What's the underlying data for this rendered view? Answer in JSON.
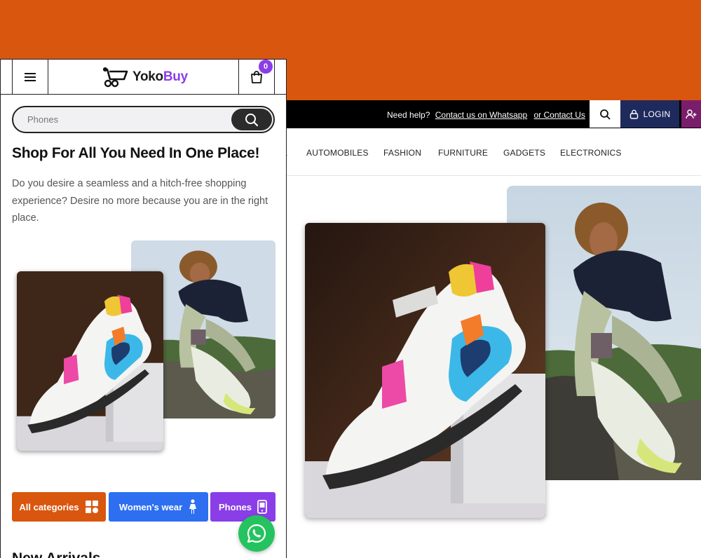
{
  "colors": {
    "orange": "#d9560f",
    "purple": "#8a3ee8",
    "blue": "#2d6ff0",
    "green": "#25c35f",
    "navy": "#1f2a5c"
  },
  "desktop": {
    "help": {
      "prefix": "Need help?",
      "whatsapp_link": "Contact us on Whatsapp",
      "contact_link": "or Contact Us"
    },
    "login_label": "LOGIN",
    "nav": [
      "E",
      "AUTOMOBILES",
      "FASHION",
      "FURNITURE",
      "GADGETS",
      "ELECTRONICS"
    ]
  },
  "mobile": {
    "brand": {
      "part1": "Yoko",
      "part2": "Buy"
    },
    "cart_count": "0",
    "search": {
      "placeholder": "Phones"
    },
    "hero_title": "Shop For All You Need In One Place!",
    "hero_desc": "Do you desire a seamless and a hitch-free shopping experience? Desire no more because you are in the right place.",
    "chips": [
      {
        "label": "All categories",
        "icon": "grid-icon"
      },
      {
        "label": "Women's wear",
        "icon": "woman-icon"
      },
      {
        "label": "Phones",
        "icon": "phone-icon"
      }
    ],
    "next_heading": "New Arrivals"
  }
}
